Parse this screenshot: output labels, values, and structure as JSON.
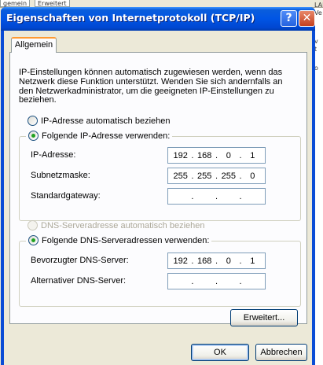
{
  "background": {
    "tabs": [
      "gemein",
      "Erweitert"
    ],
    "right_fragments": [
      "LAN-Ve",
      "v",
      "t",
      "o"
    ]
  },
  "window": {
    "title": "Eigenschaften von Internetprotokoll (TCP/IP)",
    "help_label": "?",
    "close_label": "✕"
  },
  "tab": {
    "label": "Allgemein"
  },
  "intro_text": "IP-Einstellungen können automatisch zugewiesen werden, wenn das Netzwerk diese Funktion unterstützt. Wenden Sie sich andernfalls an den Netzwerkadministrator, um die geeigneten IP-Einstellungen zu beziehen.",
  "ip": {
    "auto_label": "IP-Adresse automatisch beziehen",
    "manual_label": "Folgende IP-Adresse verwenden:",
    "address_label": "IP-Adresse:",
    "address": [
      "192",
      "168",
      "0",
      "1"
    ],
    "subnet_label": "Subnetzmaske:",
    "subnet": [
      "255",
      "255",
      "255",
      "0"
    ],
    "gateway_label": "Standardgateway:",
    "gateway": [
      "",
      "",
      "",
      ""
    ]
  },
  "dns": {
    "auto_label": "DNS-Serveradresse automatisch beziehen",
    "manual_label": "Folgende DNS-Serveradressen verwenden:",
    "preferred_label": "Bevorzugter DNS-Server:",
    "preferred": [
      "192",
      "168",
      "0",
      "1"
    ],
    "alternate_label": "Alternativer DNS-Server:",
    "alternate": [
      "",
      "",
      "",
      ""
    ]
  },
  "buttons": {
    "advanced": "Erweitert...",
    "ok": "OK",
    "cancel": "Abbrechen"
  },
  "colors": {
    "titlebar": "#0055e5",
    "window_bg": "#ece9d8",
    "radio_dot": "#21a121"
  }
}
